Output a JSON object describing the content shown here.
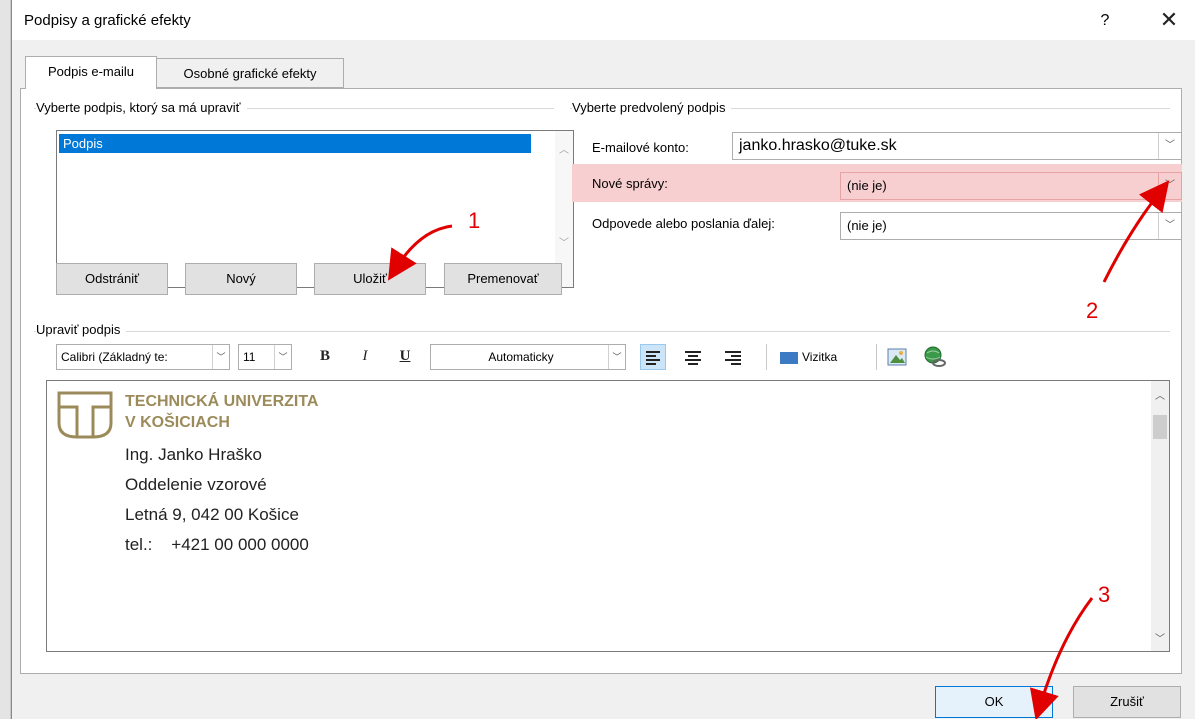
{
  "window": {
    "title": "Podpisy a grafické efekty",
    "help_glyph": "?",
    "close_glyph": "✕"
  },
  "tabs": [
    {
      "label": "Podpis e-mailu",
      "active": true
    },
    {
      "label": "Osobné grafické efekty",
      "active": false
    }
  ],
  "select_signature": {
    "group_title": "Vyberte podpis, ktorý sa má upraviť",
    "items": [
      "Podpis"
    ],
    "buttons": {
      "delete": "Odstrániť",
      "new": "Nový",
      "save": "Uložiť",
      "rename": "Premenovať"
    }
  },
  "default_signature": {
    "group_title": "Vyberte predvolený podpis",
    "account_label": "E-mailové konto:",
    "account_value": "janko.hrasko@tuke.sk",
    "new_messages_label": "Nové správy:",
    "new_messages_value": "(nie je)",
    "replies_label": "Odpovede alebo poslania ďalej:",
    "replies_value": "(nie je)"
  },
  "edit_signature": {
    "group_title": "Upraviť podpis",
    "font_value": "Calibri (Základný te:",
    "size_value": "11",
    "bold": "B",
    "italic": "I",
    "underline": "U",
    "color_value": "Automaticky",
    "business_card": "Vizitka"
  },
  "signature": {
    "org_line1": "TECHNICKÁ UNIVERZITA",
    "org_line2": "V KOŠICIACH",
    "name": "Ing. Janko Hraško",
    "department": "Oddelenie vzorové",
    "address": "Letná 9, 042 00 Košice",
    "phone": "tel.:    +421 00 000 0000"
  },
  "footer": {
    "ok": "OK",
    "cancel": "Zrušiť"
  },
  "annotations": [
    "1",
    "2",
    "3"
  ],
  "colors": {
    "selection": "#0078d7",
    "highlight": "#f8cfd1",
    "annotation": "#e00000",
    "logo": "#9c8b5a"
  }
}
